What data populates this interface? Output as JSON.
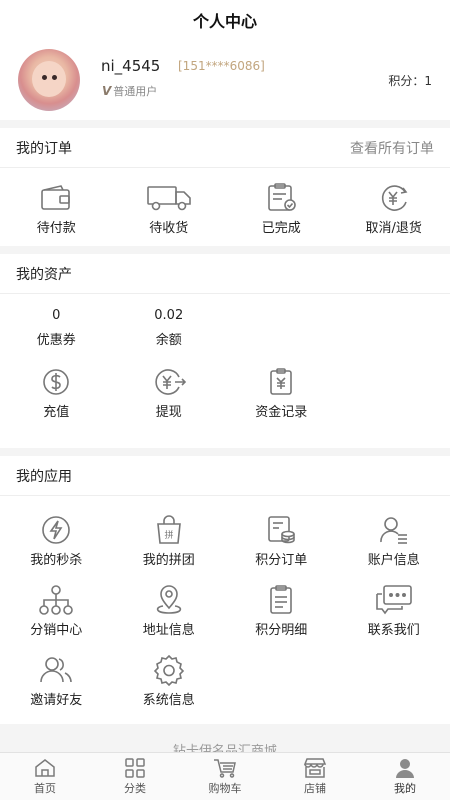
{
  "header": {
    "title": "个人中心"
  },
  "profile": {
    "username": "ni_4545",
    "phone": "[151****6086]",
    "user_type_mark": "V",
    "user_type": "普通用户",
    "points": "积分：1"
  },
  "orders": {
    "title": "我的订单",
    "view_all": "查看所有订单",
    "items": [
      {
        "label": "待付款",
        "icon": "wallet-icon"
      },
      {
        "label": "待收货",
        "icon": "truck-icon"
      },
      {
        "label": "已完成",
        "icon": "clipboard-check-icon"
      },
      {
        "label": "取消/退货",
        "icon": "yen-refund-icon"
      }
    ]
  },
  "assets": {
    "title": "我的资产",
    "values": [
      {
        "value": "0",
        "label": "优惠券"
      },
      {
        "value": "0.02",
        "label": "余额"
      }
    ],
    "items": [
      {
        "label": "充值",
        "icon": "dollar-circle-icon"
      },
      {
        "label": "提现",
        "icon": "yen-withdraw-icon"
      },
      {
        "label": "资金记录",
        "icon": "yen-record-icon"
      }
    ]
  },
  "apps": {
    "title": "我的应用",
    "items": [
      {
        "label": "我的秒杀",
        "icon": "lightning-icon"
      },
      {
        "label": "我的拼团",
        "icon": "group-bag-icon"
      },
      {
        "label": "积分订单",
        "icon": "points-order-icon"
      },
      {
        "label": "账户信息",
        "icon": "account-icon"
      },
      {
        "label": "分销中心",
        "icon": "distribution-icon"
      },
      {
        "label": "地址信息",
        "icon": "location-pin-icon"
      },
      {
        "label": "积分明细",
        "icon": "points-detail-icon"
      },
      {
        "label": "联系我们",
        "icon": "chat-icon"
      },
      {
        "label": "邀请好友",
        "icon": "invite-friends-icon"
      },
      {
        "label": "系统信息",
        "icon": "gear-icon"
      }
    ]
  },
  "footer": {
    "note": "钻卡伊名品汇商城"
  },
  "tabbar": {
    "items": [
      {
        "label": "首页",
        "icon": "home-icon"
      },
      {
        "label": "分类",
        "icon": "category-icon"
      },
      {
        "label": "购物车",
        "icon": "cart-icon"
      },
      {
        "label": "店铺",
        "icon": "store-icon"
      },
      {
        "label": "我的",
        "icon": "user-icon"
      }
    ],
    "active": "我的"
  }
}
